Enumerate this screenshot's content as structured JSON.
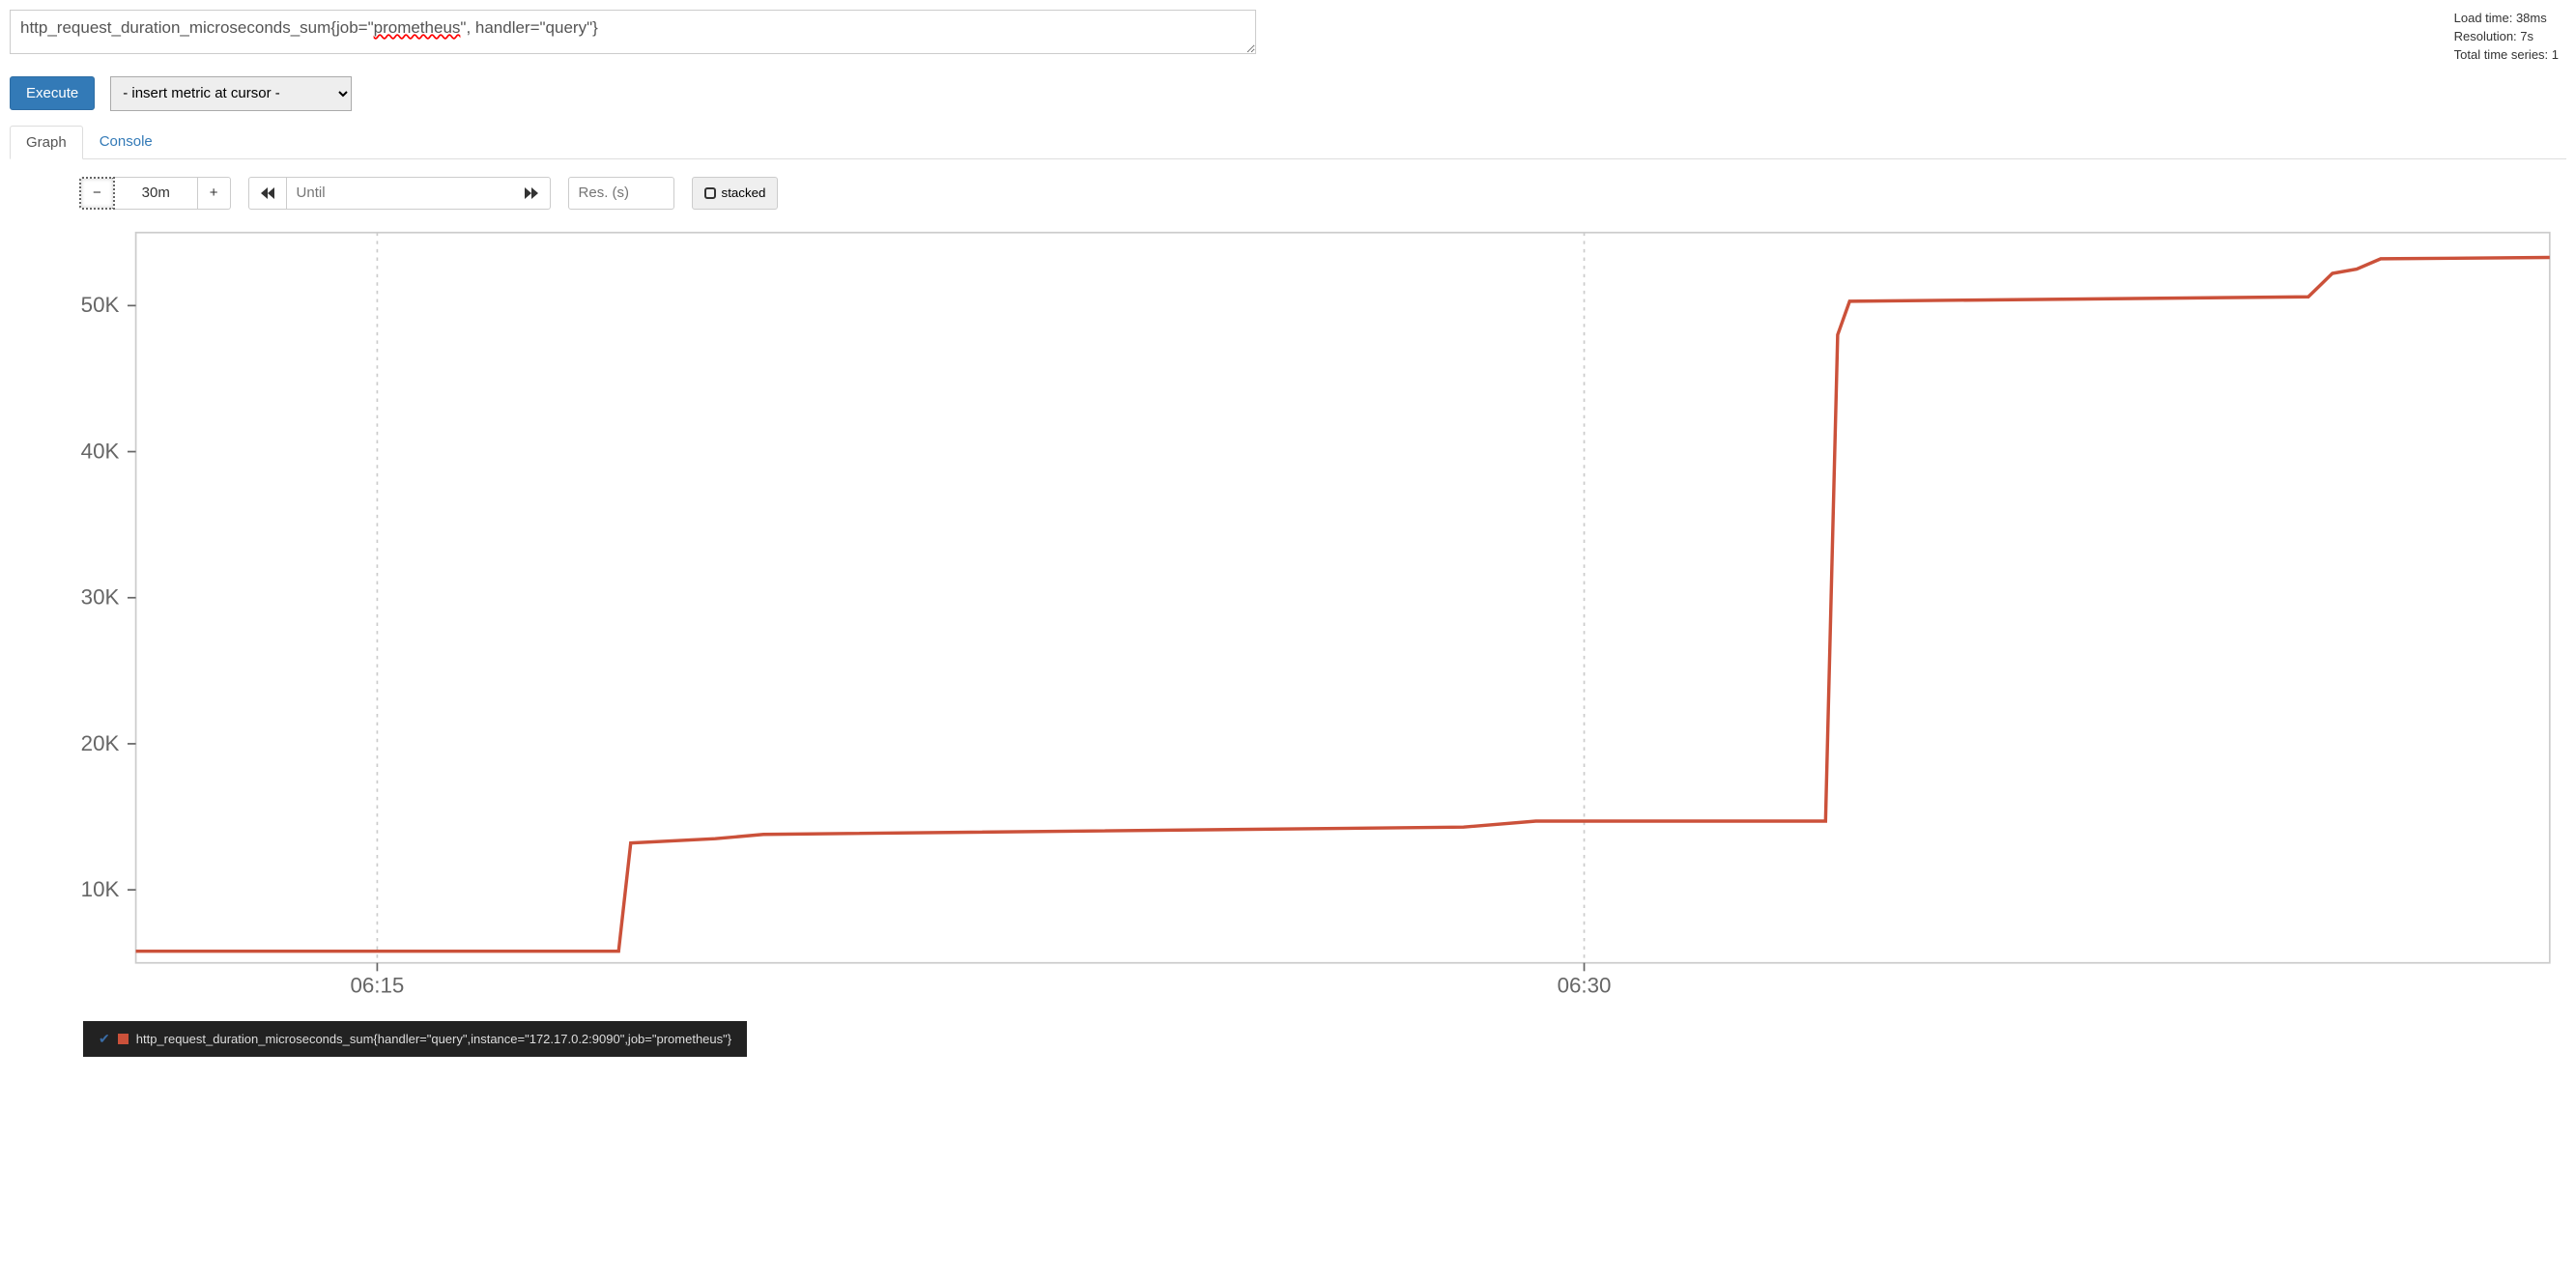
{
  "query": {
    "text_prefix": "http_request_duration_microseconds_sum{job=\"",
    "text_highlight": "prometheus",
    "text_suffix": "\", handler=\"query\"}"
  },
  "stats": {
    "load_time": "Load time: 38ms",
    "resolution": "Resolution: 7s",
    "total_series": "Total time series: 1"
  },
  "buttons": {
    "execute": "Execute"
  },
  "metric_select": {
    "selected": "- insert metric at cursor -"
  },
  "tabs": {
    "graph": "Graph",
    "console": "Console",
    "active": "graph"
  },
  "range": {
    "minus_label": "−",
    "value": "30m",
    "plus_label": "+"
  },
  "time_nav": {
    "prev_icon": "rewind",
    "until_placeholder": "Until",
    "next_icon": "forward"
  },
  "resolution": {
    "placeholder": "Res. (s)"
  },
  "stack": {
    "label": "stacked"
  },
  "chart_data": {
    "type": "line",
    "ylabel": "",
    "xlabel": "",
    "ylim": [
      5000,
      55000
    ],
    "y_ticks": [
      "10K",
      "20K",
      "30K",
      "40K",
      "50K"
    ],
    "x_ticks": [
      "06:15",
      "06:30"
    ],
    "x_range_minutes": 30,
    "series": [
      {
        "name": "http_request_duration_microseconds_sum{handler=\"query\",instance=\"172.17.0.2:9090\",job=\"prometheus\"}",
        "color": "#cb513a",
        "points": [
          [
            0.0,
            5800
          ],
          [
            0.2,
            5800
          ],
          [
            0.205,
            13200
          ],
          [
            0.24,
            13500
          ],
          [
            0.26,
            13800
          ],
          [
            0.55,
            14300
          ],
          [
            0.58,
            14700
          ],
          [
            0.7,
            14700
          ],
          [
            0.705,
            48000
          ],
          [
            0.71,
            50300
          ],
          [
            0.9,
            50600
          ],
          [
            0.91,
            52200
          ],
          [
            0.92,
            52500
          ],
          [
            0.93,
            53200
          ],
          [
            1.0,
            53300
          ]
        ]
      }
    ]
  },
  "legend_label": "http_request_duration_microseconds_sum{handler=\"query\",instance=\"172.17.0.2:9090\",job=\"prometheus\"}"
}
